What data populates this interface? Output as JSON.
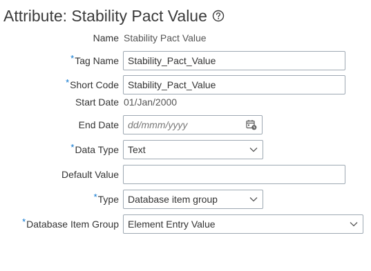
{
  "header": {
    "title": "Attribute: Stability Pact Value"
  },
  "form": {
    "name": {
      "label": "Name",
      "value": "Stability Pact Value"
    },
    "tag_name": {
      "label": "Tag Name",
      "value": "Stability_Pact_Value",
      "required": true
    },
    "short_code": {
      "label": "Short Code",
      "value": "Stability_Pact_Value",
      "required": true
    },
    "start_date": {
      "label": "Start Date",
      "value": "01/Jan/2000"
    },
    "end_date": {
      "label": "End Date",
      "placeholder": "dd/mmm/yyyy"
    },
    "data_type": {
      "label": "Data Type",
      "value": "Text",
      "required": true
    },
    "default_value": {
      "label": "Default Value",
      "value": ""
    },
    "type": {
      "label": "Type",
      "value": "Database item group",
      "required": true
    },
    "database_item_group": {
      "label": "Database Item Group",
      "value": "Element Entry Value",
      "required": true
    },
    "required_marker": "*"
  },
  "colors": {
    "required": "#0572ce",
    "border": "#9da8b2",
    "text": "#333333"
  }
}
